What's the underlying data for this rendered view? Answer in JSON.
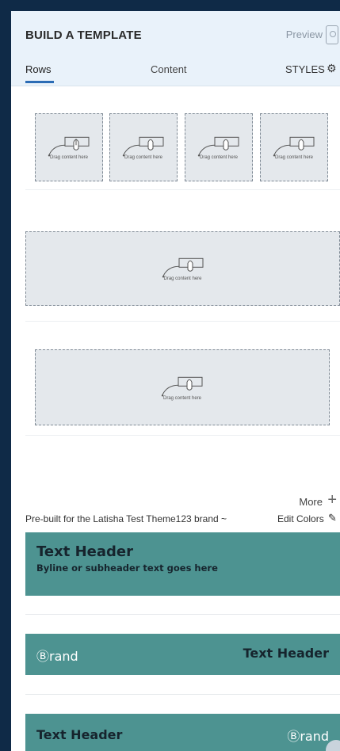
{
  "header": {
    "title": "BUILD A TEMPLATE",
    "preview_label": "Preview"
  },
  "tabs": {
    "rows": "Rows",
    "content": "Content",
    "styles": "STYLES"
  },
  "drop_zone_text": "Drag content here",
  "more": {
    "label": "More",
    "icon": "+"
  },
  "prebuilt": {
    "label": "Pre-built for the Latisha Test Theme123 brand ~",
    "edit_colors": "Edit Colors"
  },
  "templates": [
    {
      "header": "Text Header",
      "byline": "Byline or subheader text goes here"
    },
    {
      "brand": "Ⓑrand",
      "header": "Text Header"
    },
    {
      "header": "Text Header",
      "brand": "Ⓑrand"
    }
  ],
  "colors": {
    "template_bg": "#4d9391",
    "accent": "#2b6cb5",
    "frame": "#0f2a47"
  }
}
